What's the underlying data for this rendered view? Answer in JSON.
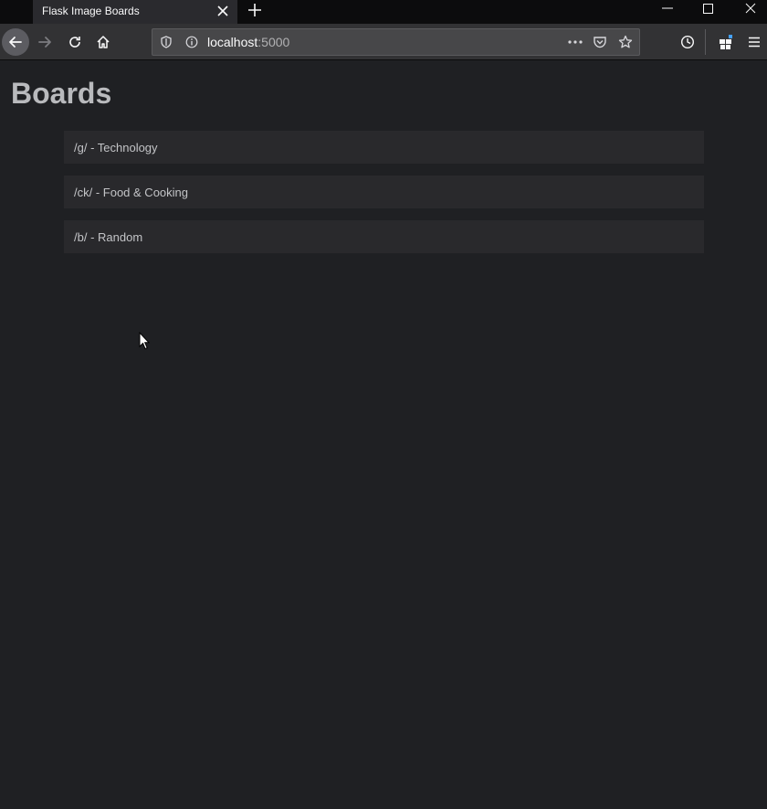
{
  "browser": {
    "tab_title": "Flask Image Boards",
    "url_host": "localhost",
    "url_port": ":5000"
  },
  "page": {
    "title": "Boards",
    "boards": [
      {
        "label": "/g/ - Technology"
      },
      {
        "label": "/ck/ - Food & Cooking"
      },
      {
        "label": "/b/ - Random"
      }
    ]
  },
  "colors": {
    "background": "#1f2023",
    "board_item_bg": "#29292c",
    "title_text": "#b9babd",
    "item_text": "#c3c4c7"
  },
  "icons": [
    "close-icon",
    "plus-icon",
    "minimize-icon",
    "maximize-icon",
    "window-close-icon",
    "back-arrow-icon",
    "forward-arrow-icon",
    "reload-icon",
    "home-icon",
    "shield-icon",
    "info-icon",
    "more-dots-icon",
    "pocket-icon",
    "star-icon",
    "history-clock-icon",
    "extensions-icon",
    "hamburger-menu-icon",
    "mouse-cursor-icon"
  ]
}
